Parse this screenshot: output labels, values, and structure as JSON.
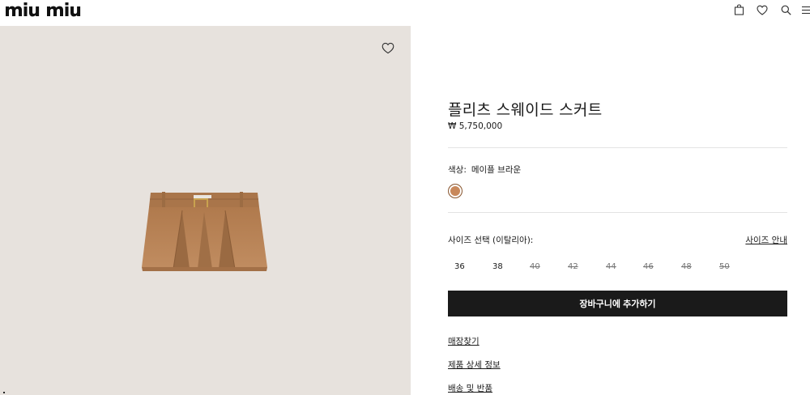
{
  "header": {
    "logo_text": "miu miu",
    "icons": [
      "bag-icon",
      "heart-icon",
      "search-icon",
      "menu-icon"
    ]
  },
  "product": {
    "title": "플리츠 스웨이드 스커트",
    "price": "₩ 5,750,000",
    "image_alt": "플리츠 스웨이드 스커트"
  },
  "color": {
    "label": "색상:",
    "value": "메이플 브라운",
    "swatch": "#c8885b"
  },
  "size": {
    "label": "사이즈 선택 (이탈리아):",
    "guide_label": "사이즈 안내",
    "options": [
      {
        "label": "36",
        "available": true
      },
      {
        "label": "38",
        "available": true
      },
      {
        "label": "40",
        "available": false
      },
      {
        "label": "42",
        "available": false
      },
      {
        "label": "44",
        "available": false
      },
      {
        "label": "46",
        "available": false
      },
      {
        "label": "48",
        "available": false
      },
      {
        "label": "50",
        "available": false
      }
    ]
  },
  "actions": {
    "add_to_cart": "장바구니에 추가하기",
    "find_store": "매장찾기",
    "product_details": "제품 상세 정보",
    "shipping_returns": "배송 및 반품"
  },
  "colors": {
    "image_bg": "#e7e2dd",
    "button_bg": "#1a1a1a",
    "skirt": "#b98558"
  }
}
